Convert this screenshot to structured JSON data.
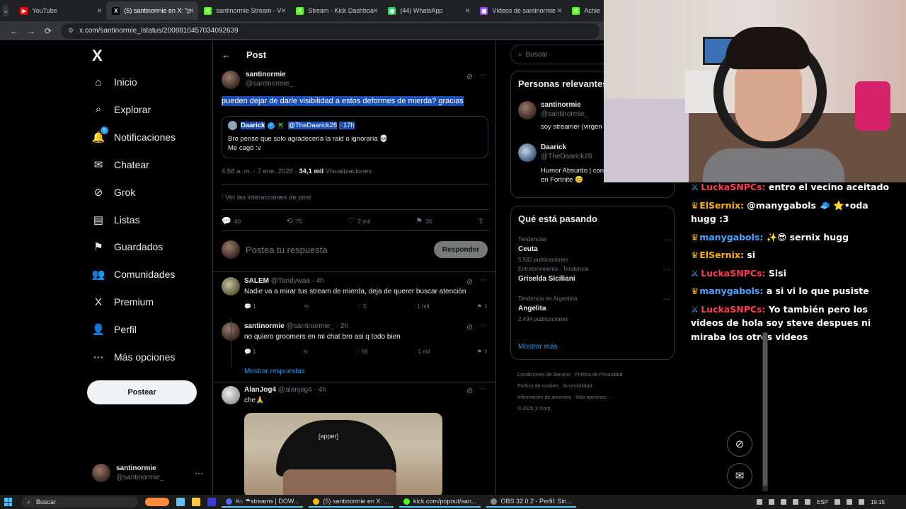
{
  "browser": {
    "tabs": [
      {
        "label": "YouTube",
        "fav": "▶",
        "color": "#ff0000",
        "active": false
      },
      {
        "label": "(5) santinormie en X: \"p",
        "fav": "X",
        "color": "#000000",
        "active": true
      },
      {
        "label": "santinormie Stream - V",
        "fav": "K",
        "color": "#53fc18",
        "active": false
      },
      {
        "label": "Stream - Kick Dashboa",
        "fav": "K",
        "color": "#53fc18",
        "active": false
      },
      {
        "label": "(44) WhatsApp",
        "fav": "◉",
        "color": "#25d366",
        "active": false
      },
      {
        "label": "Vídeos de santinormie",
        "fav": "▣",
        "color": "#9146ff",
        "active": false
      },
      {
        "label": "Achie",
        "fav": "K",
        "color": "#53fc18",
        "active": false
      }
    ],
    "url": "x.com/santinormie_/status/2008810457034092639"
  },
  "nav": {
    "logo": "X",
    "items": [
      {
        "label": "Inicio",
        "icon": "⌂",
        "name": "home"
      },
      {
        "label": "Explorar",
        "icon": "⌕",
        "name": "explore"
      },
      {
        "label": "Notificaciones",
        "icon": "🔔",
        "name": "notifications",
        "badge": "5"
      },
      {
        "label": "Chatear",
        "icon": "✉",
        "name": "chat"
      },
      {
        "label": "Grok",
        "icon": "⊘",
        "name": "grok"
      },
      {
        "label": "Listas",
        "icon": "▤",
        "name": "lists"
      },
      {
        "label": "Guardados",
        "icon": "⚑",
        "name": "bookmarks"
      },
      {
        "label": "Comunidades",
        "icon": "👥",
        "name": "communities"
      },
      {
        "label": "Premium",
        "icon": "X",
        "name": "premium"
      },
      {
        "label": "Perfil",
        "icon": "👤",
        "name": "profile"
      },
      {
        "label": "Más opciones",
        "icon": "⋯",
        "name": "more"
      }
    ],
    "post_label": "Postear",
    "me_name": "santinormie",
    "me_handle": "@santinormie_",
    "me_more": "···"
  },
  "post": {
    "header_title": "Post",
    "back": "←",
    "author_name": "santinormie",
    "author_handle": "@santinormie_",
    "more": "···",
    "grok": "⊘",
    "text": "pueden dejar de darle visibilidad a estos deformes de mierda? gracias",
    "quote": {
      "name": "Daarick",
      "verified": "✓",
      "kick": "K",
      "handle": "@TheDaarick28",
      "time": "· 17h",
      "line1": "Bro pense que solo agradecería la raid o ignoraría 💀",
      "line2": "Me cagó :v"
    },
    "meta_time": "4:58 a. m. · 7 ene. 2026 · ",
    "meta_views": "34,1 mil",
    "meta_views_label": " Visualizaciones",
    "interactions": "Ver las interacciones de post",
    "actions": [
      {
        "icon": "💬",
        "count": "40",
        "name": "reply"
      },
      {
        "icon": "⟲",
        "count": "75",
        "name": "repost"
      },
      {
        "icon": "♡",
        "count": "2 mil",
        "name": "like"
      },
      {
        "icon": "⚑",
        "count": "36",
        "name": "bookmark"
      },
      {
        "icon": "⇪",
        "count": "",
        "name": "share"
      }
    ],
    "reply_placeholder": "Postea tu respuesta",
    "reply_button": "Responder"
  },
  "replies": [
    {
      "name": "SALEM",
      "handle": "@Tandywaa · 4h",
      "text": "Nadie va a mirar tus stream de mierda, deja de querer buscar atención",
      "replies": "1",
      "reposts": "",
      "likes": "5",
      "views": "1 mil"
    },
    {
      "name": "santinormie",
      "handle": "@santinormie_ · 2h",
      "text": "no quiero groomers en mi chat bro asi q todo bien",
      "replies": "1",
      "reposts": "",
      "likes": "66",
      "views": "1 mil"
    },
    {
      "name": "AlanJog4",
      "handle": "@alanjog4 · 4h",
      "text": "che🙏",
      "replies": "",
      "reposts": "",
      "likes": "",
      "views": ""
    }
  ],
  "show_replies": "Mostrar respuestas",
  "photo_label": "[apper]",
  "right": {
    "search_placeholder": "Buscar",
    "relevant_title": "Personas relevantes",
    "people": [
      {
        "name": "santinormie",
        "handle": "@santinormie_",
        "bio": "soy streamer (virgen"
      },
      {
        "name": "Daarick",
        "handle": "@TheDaarick28",
        "bio": "Humor Absurdo | contacto.daarick@g \"Daarick\" en Fortnite 😊"
      }
    ],
    "trends_title": "Qué está pasando",
    "trends": [
      {
        "category": "Tendencias",
        "name": "Ceuta",
        "posts": "5.582 publicaciones"
      },
      {
        "category": "Entretenimiento · Tendencia",
        "name": "Griselda Siciliani",
        "posts": ""
      },
      {
        "category": "Tendencia en Argentina",
        "name": "Angelita",
        "posts": "2.494 publicaciones"
      }
    ],
    "show_more": "Mostrar más",
    "footer": [
      "Condiciones de Servicio",
      "Política de Privacidad",
      "Política de cookies",
      "Accesibilidad",
      "Información de anuncios",
      "Más opciones ···",
      "© 2026 X Corp."
    ]
  },
  "chat": [
    {
      "badge": "sword",
      "user": "LuckaSNPCs:",
      "color": "red",
      "msg": "entro el vecino aceitado"
    },
    {
      "badge": "crown",
      "user": "ElSernix:",
      "color": "gold",
      "msg": "@manygabols 🧢 ⭐•oda hugg :3"
    },
    {
      "badge": "crown",
      "user": "manygabols:",
      "color": "blue",
      "msg": "✨😎 sernix hugg"
    },
    {
      "badge": "crown",
      "user": "ElSernix:",
      "color": "gold",
      "msg": "si"
    },
    {
      "badge": "sword",
      "user": "LuckaSNPCs:",
      "color": "red",
      "msg": "Sisi"
    },
    {
      "badge": "crown",
      "user": "manygabols:",
      "color": "blue",
      "msg": "a si vi lo que pusiste"
    },
    {
      "badge": "sword",
      "user": "LuckaSNPCs:",
      "color": "red",
      "msg": "Yo también pero los videos de hola soy steve despues ni miraba los otros videos"
    }
  ],
  "taskbar": {
    "search": "Buscar",
    "windows": [
      {
        "label": "#⌂ ☂streams | DOW...",
        "color": "#5865f2"
      },
      {
        "label": "(5) santinormie en X: ...",
        "color": "#fbbc04"
      },
      {
        "label": "kick.com/popout/san...",
        "color": "#53fc18"
      },
      {
        "label": "OBS 32.0.2 - Perfil: Sin...",
        "color": "#888888"
      }
    ],
    "lang": "ESP",
    "time": "19:15"
  }
}
